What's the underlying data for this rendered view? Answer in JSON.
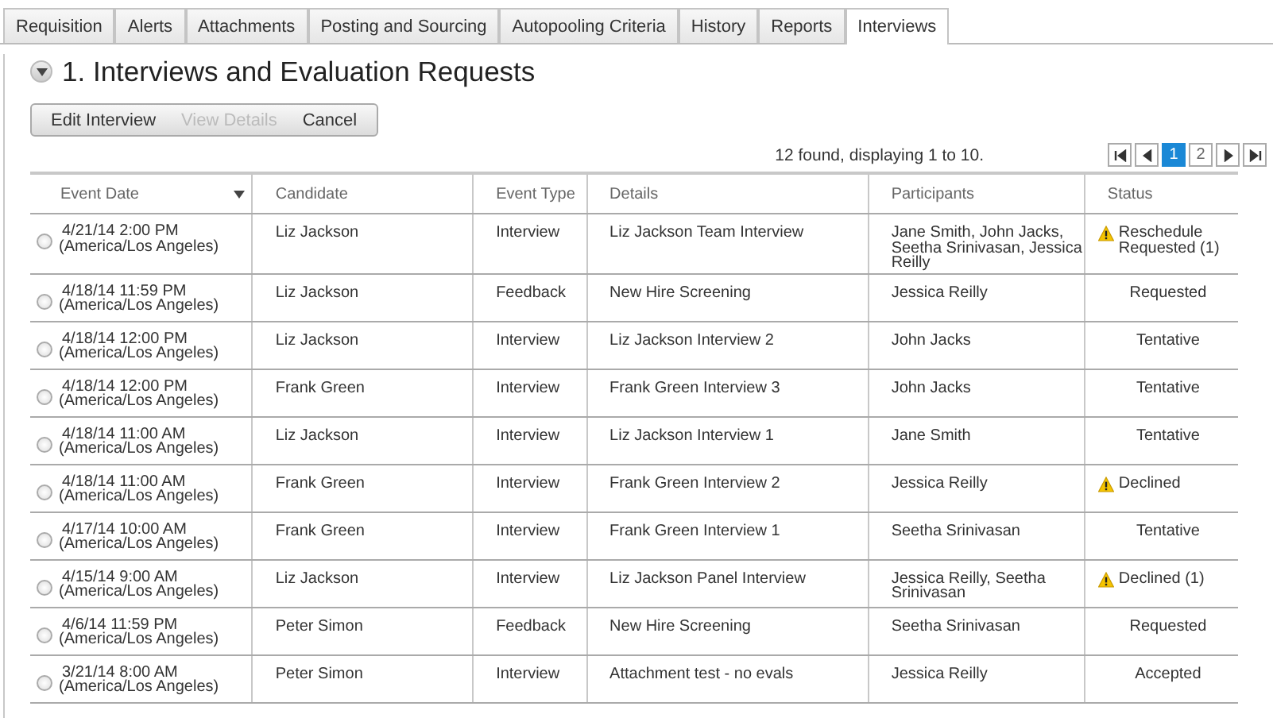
{
  "tabs": [
    {
      "label": "Requisition",
      "selected": false
    },
    {
      "label": "Alerts",
      "selected": false
    },
    {
      "label": "Attachments",
      "selected": false
    },
    {
      "label": "Posting and Sourcing",
      "selected": false
    },
    {
      "label": "Autopooling Criteria",
      "selected": false
    },
    {
      "label": "History",
      "selected": false
    },
    {
      "label": "Reports",
      "selected": false
    },
    {
      "label": "Interviews",
      "selected": true
    }
  ],
  "section": {
    "expanded": true,
    "title": "1. Interviews and Evaluation Requests"
  },
  "actions": [
    {
      "label": "Edit Interview",
      "disabled": false
    },
    {
      "label": "View Details",
      "disabled": true
    },
    {
      "label": "Cancel",
      "disabled": false
    }
  ],
  "result_count": "12 found, displaying 1 to 10.",
  "pagination": [
    {
      "kind": "first",
      "selected": false
    },
    {
      "kind": "prev",
      "selected": false
    },
    {
      "kind": "page",
      "label": "1",
      "selected": true
    },
    {
      "kind": "page",
      "label": "2",
      "selected": false
    },
    {
      "kind": "next",
      "selected": false
    },
    {
      "kind": "last",
      "selected": false
    }
  ],
  "table": {
    "columns": [
      {
        "label": "Event Date",
        "sorted": true
      },
      {
        "label": "Candidate",
        "sorted": false
      },
      {
        "label": "Event Type",
        "sorted": false
      },
      {
        "label": "Details",
        "sorted": false
      },
      {
        "label": "Participants",
        "sorted": false
      },
      {
        "label": "Status",
        "sorted": false
      }
    ],
    "rows": [
      {
        "selected": false,
        "date": "4/21/14 2:00 PM",
        "timezone": "(America/Los Angeles)",
        "candidate": "Liz Jackson",
        "event_type": "Interview",
        "details": "Liz Jackson Team Interview",
        "participants": "Jane Smith, John Jacks, Seetha Srinivasan, Jessica Reilly",
        "status": "Reschedule Requested (1)",
        "warning": true
      },
      {
        "selected": false,
        "date": "4/18/14 11:59 PM",
        "timezone": "(America/Los Angeles)",
        "candidate": "Liz Jackson",
        "event_type": "Feedback",
        "details": "New Hire Screening",
        "participants": "Jessica Reilly",
        "status": "Requested",
        "warning": false
      },
      {
        "selected": false,
        "date": "4/18/14 12:00 PM",
        "timezone": "(America/Los Angeles)",
        "candidate": "Liz Jackson",
        "event_type": "Interview",
        "details": "Liz Jackson Interview 2",
        "participants": "John Jacks",
        "status": "Tentative",
        "warning": false
      },
      {
        "selected": false,
        "date": "4/18/14 12:00 PM",
        "timezone": "(America/Los Angeles)",
        "candidate": "Frank Green",
        "event_type": "Interview",
        "details": "Frank Green Interview 3",
        "participants": "John Jacks",
        "status": "Tentative",
        "warning": false
      },
      {
        "selected": false,
        "date": "4/18/14 11:00 AM",
        "timezone": "(America/Los Angeles)",
        "candidate": "Liz Jackson",
        "event_type": "Interview",
        "details": "Liz Jackson Interview 1",
        "participants": "Jane Smith",
        "status": "Tentative",
        "warning": false
      },
      {
        "selected": false,
        "date": "4/18/14 11:00 AM",
        "timezone": "(America/Los Angeles)",
        "candidate": "Frank Green",
        "event_type": "Interview",
        "details": "Frank Green Interview 2",
        "participants": "Jessica Reilly",
        "status": "Declined",
        "warning": true
      },
      {
        "selected": false,
        "date": "4/17/14 10:00 AM",
        "timezone": "(America/Los Angeles)",
        "candidate": "Frank Green",
        "event_type": "Interview",
        "details": "Frank Green Interview 1",
        "participants": "Seetha Srinivasan",
        "status": "Tentative",
        "warning": false
      },
      {
        "selected": false,
        "date": "4/15/14 9:00 AM",
        "timezone": "(America/Los Angeles)",
        "candidate": "Liz Jackson",
        "event_type": "Interview",
        "details": "Liz Jackson Panel Interview",
        "participants": "Jessica Reilly, Seetha Srinivasan",
        "status": "Declined (1)",
        "warning": true
      },
      {
        "selected": false,
        "date": "4/6/14 11:59 PM",
        "timezone": "(America/Los Angeles)",
        "candidate": "Peter Simon",
        "event_type": "Feedback",
        "details": "New Hire Screening",
        "participants": "Seetha Srinivasan",
        "status": "Requested",
        "warning": false
      },
      {
        "selected": false,
        "date": "3/21/14 8:00 AM",
        "timezone": "(America/Los Angeles)",
        "candidate": "Peter Simon",
        "event_type": "Interview",
        "details": "Attachment test - no evals",
        "participants": "Jessica Reilly",
        "status": "Accepted",
        "warning": false
      }
    ]
  }
}
